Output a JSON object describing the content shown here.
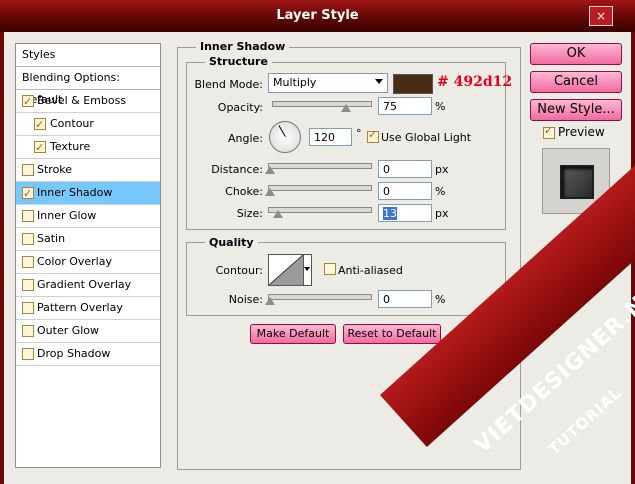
{
  "window": {
    "title": "Layer Style",
    "close_label": "×"
  },
  "sidebar": {
    "header": "Styles",
    "blending": "Blending Options: Default",
    "items": [
      {
        "label": "Bevel & Emboss",
        "checked": true,
        "indent": false,
        "selected": false
      },
      {
        "label": "Contour",
        "checked": true,
        "indent": true,
        "selected": false
      },
      {
        "label": "Texture",
        "checked": true,
        "indent": true,
        "selected": false
      },
      {
        "label": "Stroke",
        "checked": false,
        "indent": false,
        "selected": false
      },
      {
        "label": "Inner Shadow",
        "checked": true,
        "indent": false,
        "selected": true
      },
      {
        "label": "Inner Glow",
        "checked": false,
        "indent": false,
        "selected": false
      },
      {
        "label": "Satin",
        "checked": false,
        "indent": false,
        "selected": false
      },
      {
        "label": "Color Overlay",
        "checked": false,
        "indent": false,
        "selected": false
      },
      {
        "label": "Gradient Overlay",
        "checked": false,
        "indent": false,
        "selected": false
      },
      {
        "label": "Pattern Overlay",
        "checked": false,
        "indent": false,
        "selected": false
      },
      {
        "label": "Outer Glow",
        "checked": false,
        "indent": false,
        "selected": false
      },
      {
        "label": "Drop Shadow",
        "checked": false,
        "indent": false,
        "selected": false
      }
    ]
  },
  "panel": {
    "title": "Inner Shadow",
    "structure": {
      "title": "Structure",
      "blend_mode_label": "Blend Mode:",
      "blend_mode": "Multiply",
      "shadow_color": "#492d12",
      "color_annotation": "# 492d12",
      "opacity_label": "Opacity:",
      "opacity": "75",
      "opacity_level": 0.75,
      "percent": "%",
      "angle_label": "Angle:",
      "angle": "120",
      "degree": "°",
      "global_light_label": "Use Global Light",
      "distance_label": "Distance:",
      "distance": "0",
      "px": "px",
      "choke_label": "Choke:",
      "choke": "0",
      "size_label": "Size:",
      "size": "13",
      "size_level": 0.1
    },
    "quality": {
      "title": "Quality",
      "contour_label": "Contour:",
      "anti_aliased_label": "Anti-aliased",
      "noise_label": "Noise:",
      "noise": "0"
    },
    "make_default": "Make Default",
    "reset_default": "Reset to Default"
  },
  "actions": {
    "ok": "OK",
    "cancel": "Cancel",
    "new_style": "New Style...",
    "preview_label": "Preview"
  },
  "watermark": {
    "line1": "VIETDESIGNER.NET",
    "line2": "TUTORIAL"
  }
}
